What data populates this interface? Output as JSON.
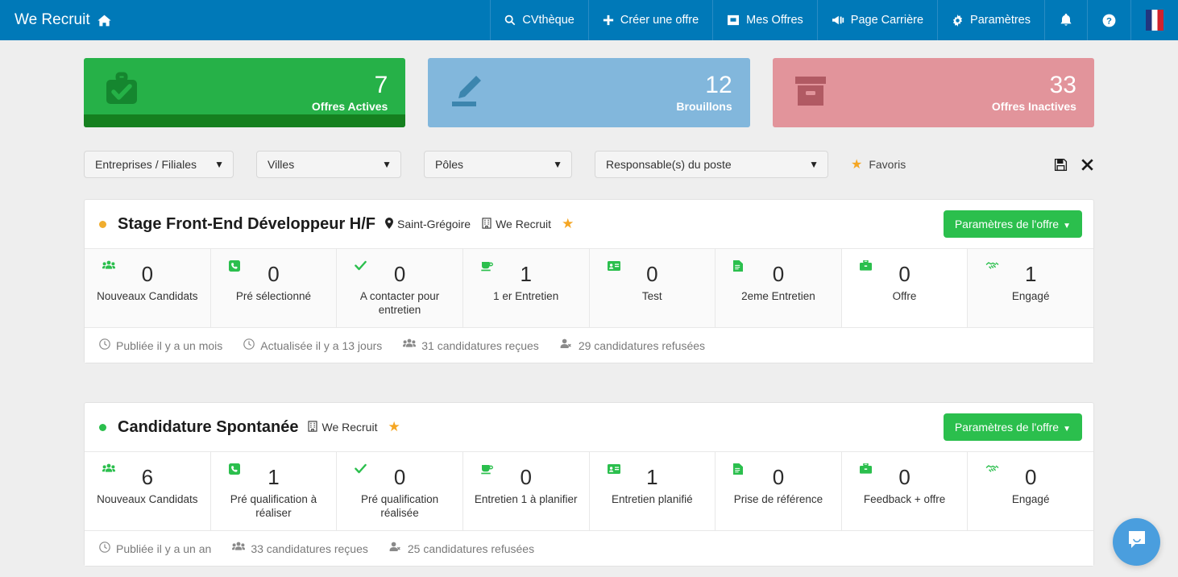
{
  "navbar": {
    "brand": "We Recruit",
    "brand_icon": "home-icon",
    "background": "#0079b8",
    "items": [
      {
        "label": "CVthèque",
        "icon": "search-icon"
      },
      {
        "label": "Créer une offre",
        "icon": "plus-icon"
      },
      {
        "label": "Mes Offres",
        "icon": "inbox-icon"
      },
      {
        "label": "Page Carrière",
        "icon": "bullhorn-icon"
      },
      {
        "label": "Paramètres",
        "icon": "gear-icon"
      }
    ],
    "notifications_icon": "bell-icon",
    "help_icon": "question-circle-icon",
    "language_flag": "fr-flag-icon"
  },
  "stats": [
    {
      "value": "7",
      "label": "Offres Actives",
      "icon": "briefcase-check-icon",
      "bg": "#26b148",
      "icon_color": "#15852f",
      "bar_color": "#15801f",
      "has_bar": true
    },
    {
      "value": "12",
      "label": "Brouillons",
      "icon": "pencil-edit-icon",
      "bg": "#82b7dc",
      "icon_color": "#3a84ad",
      "bar_color": "",
      "has_bar": false
    },
    {
      "value": "33",
      "label": "Offres Inactives",
      "icon": "archive-box-icon",
      "bg": "#e2949b",
      "icon_color": "#b05862",
      "bar_color": "",
      "has_bar": false
    }
  ],
  "filters": {
    "selects": [
      {
        "label": "Entreprises / Filiales"
      },
      {
        "label": "Villes"
      },
      {
        "label": "Pôles"
      },
      {
        "label": "Responsable(s) du poste"
      }
    ],
    "favoris_label": "Favoris",
    "favoris_icon": "star-icon",
    "save_icon": "floppy-save-icon",
    "close_icon": "close-x-icon"
  },
  "offers": [
    {
      "status_color": "#f0ad2e",
      "title": "Stage Front-End Développeur H/F",
      "location": "Saint-Grégoire",
      "location_icon": "map-pin-icon",
      "company": "We Recruit",
      "company_icon": "building-icon",
      "favorite_icon": "star-icon",
      "settings_label": "Paramètres de l'offre",
      "settings_color": "#2bbf4d",
      "pipeline": [
        {
          "value": "0",
          "label": "Nouveaux Candidats",
          "icon": "users-icon",
          "highlight": false
        },
        {
          "value": "0",
          "label": "Pré sélectionné",
          "icon": "phone-square-icon",
          "highlight": false
        },
        {
          "value": "0",
          "label": "A contacter pour entretien",
          "icon": "check-icon",
          "highlight": false
        },
        {
          "value": "1",
          "label": "1 er Entretien",
          "icon": "coffee-icon",
          "highlight": false
        },
        {
          "value": "0",
          "label": "Test",
          "icon": "id-card-icon",
          "highlight": false
        },
        {
          "value": "0",
          "label": "2eme Entretien",
          "icon": "file-text-icon",
          "highlight": false
        },
        {
          "value": "0",
          "label": "Offre",
          "icon": "briefcase-icon",
          "highlight": true
        },
        {
          "value": "1",
          "label": "Engagé",
          "icon": "handshake-icon",
          "highlight": false
        }
      ],
      "footer": [
        {
          "icon": "clock-icon",
          "text": "Publiée il y a un mois"
        },
        {
          "icon": "clock-icon",
          "text": "Actualisée il y a 13 jours"
        },
        {
          "icon": "users-icon",
          "text": "31 candidatures reçues"
        },
        {
          "icon": "user-times-icon",
          "text": "29 candidatures refusées"
        }
      ]
    },
    {
      "status_color": "#2bbf4d",
      "title": "Candidature Spontanée",
      "location": "",
      "location_icon": "",
      "company": "We Recruit",
      "company_icon": "building-icon",
      "favorite_icon": "star-icon",
      "settings_label": "Paramètres de l'offre",
      "settings_color": "#2bbf4d",
      "pipeline": [
        {
          "value": "6",
          "label": "Nouveaux Candidats",
          "icon": "users-icon",
          "highlight": true
        },
        {
          "value": "1",
          "label": "Pré qualification à réaliser",
          "icon": "phone-square-icon",
          "highlight": true
        },
        {
          "value": "0",
          "label": "Pré qualification réalisée",
          "icon": "check-icon",
          "highlight": true
        },
        {
          "value": "0",
          "label": "Entretien 1 à planifier",
          "icon": "coffee-icon",
          "highlight": true
        },
        {
          "value": "1",
          "label": "Entretien planifié",
          "icon": "id-card-icon",
          "highlight": true
        },
        {
          "value": "0",
          "label": "Prise de référence",
          "icon": "file-text-icon",
          "highlight": true
        },
        {
          "value": "0",
          "label": "Feedback + offre",
          "icon": "briefcase-icon",
          "highlight": true
        },
        {
          "value": "0",
          "label": "Engagé",
          "icon": "handshake-icon",
          "highlight": true
        }
      ],
      "footer": [
        {
          "icon": "clock-icon",
          "text": "Publiée il y a un an"
        },
        {
          "icon": "users-icon",
          "text": "33 candidatures reçues"
        },
        {
          "icon": "user-times-icon",
          "text": "25 candidatures refusées"
        }
      ]
    }
  ],
  "chat_widget": {
    "icon": "chat-bubble-icon",
    "color": "#4a9ede"
  }
}
